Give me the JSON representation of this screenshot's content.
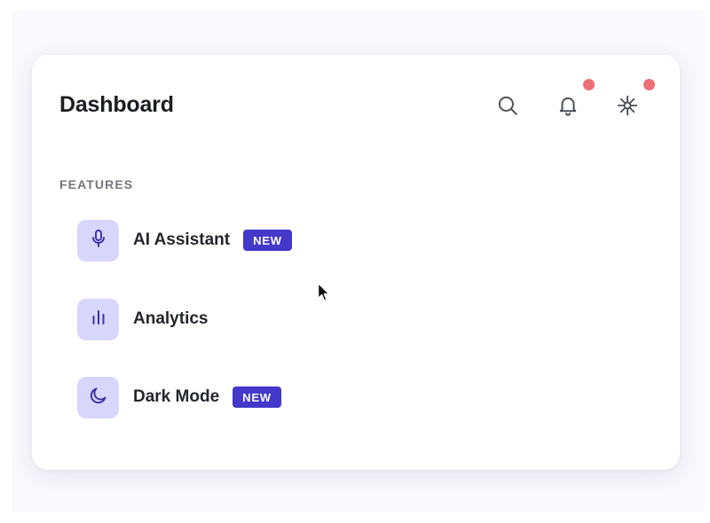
{
  "header": {
    "title": "Dashboard",
    "actions": [
      {
        "icon": "search-icon"
      },
      {
        "icon": "bell-icon",
        "has_notification": true
      },
      {
        "icon": "sparkle-icon",
        "has_notification": true
      }
    ]
  },
  "features": {
    "section_label": "FEATURES",
    "items": [
      {
        "label": "AI Assistant",
        "icon": "microphone-icon",
        "badge": "NEW"
      },
      {
        "label": "Analytics",
        "icon": "bar-chart-icon",
        "badge": ""
      },
      {
        "label": "Dark Mode",
        "icon": "moon-icon",
        "badge": "NEW"
      }
    ]
  },
  "colors": {
    "accent": "#4338ca",
    "icon_tile": "#d9d6fb",
    "icon_stroke": "#3b2fa8",
    "notification": "#ee6f78",
    "title_text": "#1c1d22",
    "muted_text": "#74767f"
  }
}
